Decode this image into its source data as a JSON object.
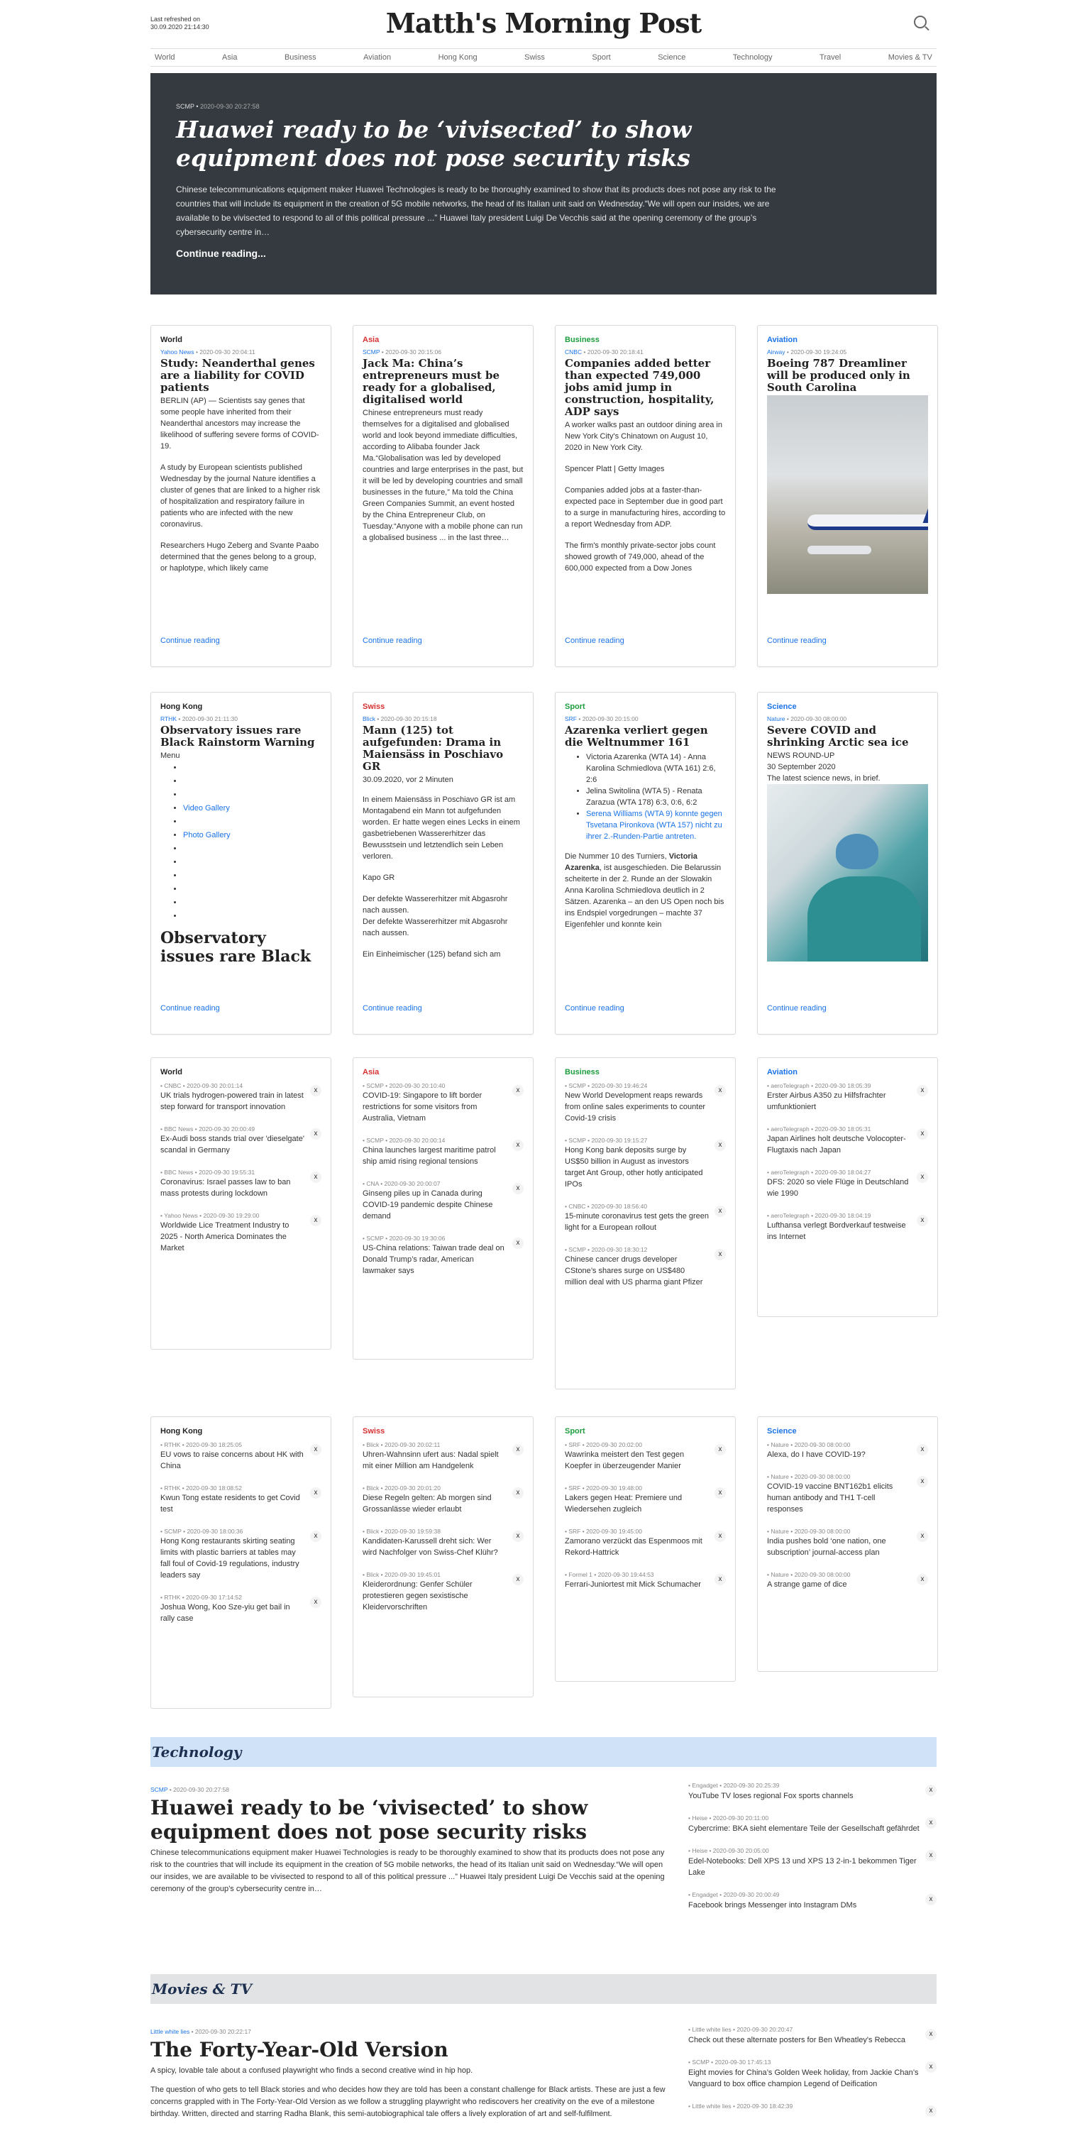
{
  "header": {
    "refresh_label": "Last refreshed on",
    "refresh_time": "30.09.2020 21:14:30",
    "title": "Matth's Morning Post"
  },
  "nav": [
    "World",
    "Asia",
    "Business",
    "Aviation",
    "Hong Kong",
    "Swiss",
    "Sport",
    "Science",
    "Technology",
    "Travel",
    "Movies & TV"
  ],
  "hero": {
    "source": "SCMP",
    "time": "2020-09-30 20:27:58",
    "title": "Huawei ready to be ‘vivisected’ to show equipment does not pose security risks",
    "summary": "Chinese telecommunications equipment maker Huawei Technologies is ready to be thoroughly examined to show that its products does not pose any risk to the countries that will include its equipment in the creation of 5G mobile networks, the head of its Italian unit said on Wednesday.“We will open our insides, we are available to be vivisected to respond to all of this political pressure ...” Huawei Italy president Luigi De Vecchis said at the opening ceremony of the group’s cybersecurity centre in…",
    "more": "Continue reading..."
  },
  "colors": {
    "World": "#222222",
    "Asia": "#d63031",
    "Business": "#1e9e3e",
    "Aviation": "#1a73e8",
    "Hong Kong": "#222222",
    "Swiss": "#d63031",
    "Sport": "#1e9e3e",
    "Science": "#1a73e8",
    "tech_bar": "#cfe2f8",
    "movies_bar": "#e2e3e5"
  },
  "cards": [
    {
      "cat": "World",
      "src": "Yahoo News",
      "time": "2020-09-30 20:04:11",
      "title": "Study: Neanderthal genes are a liability for COVID patients",
      "paras": [
        "BERLIN (AP) — Scientists say genes that some people have inherited from their Neanderthal ancestors may increase the likelihood of suffering severe forms of COVID-19.",
        "A study by European scientists published Wednesday by the journal Nature identifies a cluster of genes that are linked to a higher risk of hospitalization and respiratory failure in patients who are infected with the new coronavirus.",
        "Researchers Hugo Zeberg and Svante Paabo determined that the genes belong to a group, or haplotype, which likely came"
      ],
      "more": "Continue reading"
    },
    {
      "cat": "Asia",
      "src": "SCMP",
      "time": "2020-09-30 20:15:06",
      "title": "Jack Ma: China’s entrepreneurs must be ready for a globalised, digitalised world",
      "paras": [
        "Chinese entrepreneurs must ready themselves for a digitalised and globalised world and look beyond immediate difficulties, according to Alibaba founder Jack Ma.“Globalisation was led by developed countries and large enterprises in the past, but it will be led by developing countries and small businesses in the future,” Ma told the China Green Companies Summit, an event hosted by the China Entrepreneur Club, on Tuesday.“Anyone with a mobile phone can run a globalised business ... in the last three…"
      ],
      "more": "Continue reading"
    },
    {
      "cat": "Business",
      "src": "CNBC",
      "time": "2020-09-30 20:18:41",
      "title": "Companies added better than expected 749,000 jobs amid jump in construction, hospitality, ADP says",
      "paras": [
        "A worker walks past an outdoor dining area in New York City's Chinatown on August 10, 2020 in New York City.",
        "Spencer Platt | Getty Images",
        "Companies added jobs at a faster-than-expected pace in September due in good part to a surge in manufacturing hires, according to a report Wednesday from ADP.",
        "The firm's monthly private-sector jobs count showed growth of 749,000, ahead of the 600,000 expected from a Dow Jones"
      ],
      "more": "Continue reading"
    },
    {
      "cat": "Aviation",
      "src": "Airway",
      "time": "2020-09-30 19:24:05",
      "title": "Boeing 787 Dreamliner will be produced only in South Carolina",
      "paras": [],
      "more": "Continue reading"
    },
    {
      "cat": "Hong Kong",
      "src": "RTHK",
      "time": "2020-09-30 21:11:30",
      "title": "Observatory issues rare Black Rainstorm Warning",
      "menu": "Menu",
      "links": [
        "Video Gallery",
        "Photo Gallery"
      ],
      "bigtitle": "Observatory issues rare Black Rainstorm Warning",
      "more": "Continue reading"
    },
    {
      "cat": "Swiss",
      "src": "Blick",
      "time": "2020-09-30 20:15:18",
      "title": "Mann (125) tot aufgefunden: Drama in Maiensäss in Poschiavo GR",
      "date": "30.09.2020, vor 2 Minuten",
      "paras": [
        "In einem Maiensäss in Poschiavo GR ist am Montagabend ein Mann tot aufgefunden worden. Er hatte wegen eines Lecks in einem gasbetriebenen Wassererhitzer das Bewusstsein und letztendlich sein Leben verloren.",
        "Kapo GR",
        "Der defekte Wassererhitzer mit Abgasrohr nach aussen.\nDer defekte Wassererhitzer mit Abgasrohr nach aussen.",
        "Ein Einheimischer (125) befand sich am"
      ],
      "more": "Continue reading"
    },
    {
      "cat": "Sport",
      "src": "SRF",
      "time": "2020-09-30 20:15:00",
      "title": "Azarenka verliert gegen die Weltnummer 161",
      "bullets": [
        "Victoria Azarenka (WTA 14) - Anna Karolina Schmiedlova (WTA 161) 2:6, 2:6",
        "Jelina Switolina (WTA 5) - Renata Zarazua (WTA 178) 6:3, 0:6, 6:2"
      ],
      "link": "Serena Williams (WTA 9) konnte gegen Tsvetana Pironkova (WTA 157) nicht zu ihrer 2.-Runden-Partie antreten.",
      "para_pre": "Die Nummer 10 des Turniers, ",
      "para_bold": "Victoria Azarenka",
      "para_post": ", ist ausgeschieden. Die Belarussin scheiterte in der 2. Runde an der Slowakin Anna Karolina Schmiedlova deutlich in 2 Sätzen. Azarenka – an den US Open noch bis ins Endspiel vorgedrungen – machte 37 Eigenfehler und konnte kein",
      "more": "Continue reading"
    },
    {
      "cat": "Science",
      "src": "Nature",
      "time": "2020-09-30 08:00:00",
      "title": "Severe COVID and shrinking Arctic sea ice",
      "lines": [
        "NEWS ROUND-UP",
        "30 September 2020",
        "The latest science news, in brief."
      ],
      "more": "Continue reading"
    }
  ],
  "lists1": [
    {
      "cat": "World",
      "items": [
        {
          "src": "CNBC",
          "time": "2020-09-30 20:01:14",
          "title": "UK trials hydrogen-powered train in latest step forward for transport innovation"
        },
        {
          "src": "BBC News",
          "time": "2020-09-30 20:00:49",
          "title": "Ex-Audi boss stands trial over 'dieselgate' scandal in Germany"
        },
        {
          "src": "BBC News",
          "time": "2020-09-30 19:55:31",
          "title": "Coronavirus: Israel passes law to ban mass protests during lockdown"
        },
        {
          "src": "Yahoo News",
          "time": "2020-09-30 19:29:00",
          "title": "Worldwide Lice Treatment Industry to 2025 - North America Dominates the Market"
        }
      ]
    },
    {
      "cat": "Asia",
      "items": [
        {
          "src": "SCMP",
          "time": "2020-09-30 20:10:40",
          "title": "COVID-19: Singapore to lift border restrictions for some visitors from Australia, Vietnam"
        },
        {
          "src": "SCMP",
          "time": "2020-09-30 20:00:14",
          "title": "China launches largest maritime patrol ship amid rising regional tensions"
        },
        {
          "src": "CNA",
          "time": "2020-09-30 20:00:07",
          "title": "Ginseng piles up in Canada during COVID-19 pandemic despite Chinese demand"
        },
        {
          "src": "SCMP",
          "time": "2020-09-30 19:30:06",
          "title": "US-China relations: Taiwan trade deal on Donald Trump’s radar, American lawmaker says"
        }
      ]
    },
    {
      "cat": "Business",
      "items": [
        {
          "src": "SCMP",
          "time": "2020-09-30 19:46:24",
          "title": "New World Development reaps rewards from online sales experiments to counter Covid-19 crisis"
        },
        {
          "src": "SCMP",
          "time": "2020-09-30 19:15:27",
          "title": "Hong Kong bank deposits surge by US$50 billion in August as investors target Ant Group, other hotly anticipated IPOs"
        },
        {
          "src": "CNBC",
          "time": "2020-09-30 18:56:40",
          "title": "15-minute coronavirus test gets the green light for a European rollout"
        },
        {
          "src": "SCMP",
          "time": "2020-09-30 18:30:12",
          "title": "Chinese cancer drugs developer CStone’s shares surge on US$480 million deal with US pharma giant Pfizer"
        }
      ]
    },
    {
      "cat": "Aviation",
      "items": [
        {
          "src": "aeroTelegraph",
          "time": "2020-09-30 18:05:39",
          "title": "Erster Airbus A350 zu Hilfsfrachter umfunktioniert"
        },
        {
          "src": "aeroTelegraph",
          "time": "2020-09-30 18:05:31",
          "title": "Japan Airlines holt deutsche Volocopter-Flugtaxis nach Japan"
        },
        {
          "src": "aeroTelegraph",
          "time": "2020-09-30 18:04:27",
          "title": "DFS: 2020 so viele Flüge in Deutschland wie 1990"
        },
        {
          "src": "aeroTelegraph",
          "time": "2020-09-30 18:04:19",
          "title": "Lufthansa verlegt Bordverkauf testweise ins Internet"
        }
      ]
    }
  ],
  "lists2": [
    {
      "cat": "Hong Kong",
      "items": [
        {
          "src": "RTHK",
          "time": "2020-09-30 18:25:05",
          "title": "EU vows to raise concerns about HK with China"
        },
        {
          "src": "RTHK",
          "time": "2020-09-30 18:08:52",
          "title": "Kwun Tong estate residents to get Covid test"
        },
        {
          "src": "SCMP",
          "time": "2020-09-30 18:00:36",
          "title": "Hong Kong restaurants skirting seating limits with plastic barriers at tables may fall foul of Covid-19 regulations, industry leaders say"
        },
        {
          "src": "RTHK",
          "time": "2020-09-30 17:14:52",
          "title": "Joshua Wong, Koo Sze-yiu get bail in rally case"
        }
      ]
    },
    {
      "cat": "Swiss",
      "items": [
        {
          "src": "Blick",
          "time": "2020-09-30 20:02:11",
          "title": "Uhren-Wahnsinn ufert aus: Nadal spielt mit einer Million am Handgelenk"
        },
        {
          "src": "Blick",
          "time": "2020-09-30 20:01:20",
          "title": "Diese Regeln gelten: Ab morgen sind Grossanlässe wieder erlaubt"
        },
        {
          "src": "Blick",
          "time": "2020-09-30 19:59:38",
          "title": "Kandidaten-Karussell dreht sich: Wer wird Nachfolger von Swiss-Chef Klühr?"
        },
        {
          "src": "Blick",
          "time": "2020-09-30 19:45:01",
          "title": "Kleiderordnung: Genfer Schüler protestieren gegen sexistische Kleidervorschriften"
        }
      ]
    },
    {
      "cat": "Sport",
      "items": [
        {
          "src": "SRF",
          "time": "2020-09-30 20:02:00",
          "title": "Wawrinka meistert den Test gegen Koepfer in überzeugender Manier"
        },
        {
          "src": "SRF",
          "time": "2020-09-30 19:48:00",
          "title": "Lakers gegen Heat: Premiere und Wiedersehen zugleich"
        },
        {
          "src": "SRF",
          "time": "2020-09-30 19:45:00",
          "title": "Zamorano verzückt das Espenmoos mit Rekord-Hattrick"
        },
        {
          "src": "Formel 1",
          "time": "2020-09-30 19:44:53",
          "title": "Ferrari-Juniortest mit Mick Schumacher"
        }
      ]
    },
    {
      "cat": "Science",
      "items": [
        {
          "src": "Nature",
          "time": "2020-09-30 08:00:00",
          "title": "Alexa, do I have COVID-19?"
        },
        {
          "src": "Nature",
          "time": "2020-09-30 08:00:00",
          "title": "COVID-19 vaccine BNT162b1 elicits human antibody and TH1 T-cell responses"
        },
        {
          "src": "Nature",
          "time": "2020-09-30 08:00:00",
          "title": "India pushes bold ‘one nation, one subscription’ journal-access plan"
        },
        {
          "src": "Nature",
          "time": "2020-09-30 08:00:00",
          "title": "A strange game of dice"
        }
      ]
    }
  ],
  "x_label": "x",
  "technology": {
    "label": "Technology",
    "src": "SCMP",
    "time": "2020-09-30 20:27:58",
    "title": "Huawei ready to be ‘vivisected’ to show equipment does not pose security risks",
    "summary": "Chinese telecommunications equipment maker Huawei Technologies is ready to be thoroughly examined to show that its products does not pose any risk to the countries that will include its equipment in the creation of 5G mobile networks, the head of its Italian unit said on Wednesday.“We will open our insides, we are available to be vivisected to respond to all of this political pressure ...” Huawei Italy president Luigi De Vecchis said at the opening ceremony of the group’s cybersecurity centre in…",
    "side": [
      {
        "src": "Engadget",
        "time": "2020-09-30 20:25:39",
        "title": "YouTube TV loses regional Fox sports channels"
      },
      {
        "src": "Heise",
        "time": "2020-09-30 20:11:00",
        "title": "Cybercrime: BKA sieht elementare Teile der Gesellschaft gefährdet"
      },
      {
        "src": "Heise",
        "time": "2020-09-30 20:05:00",
        "title": "Edel-Notebooks: Dell XPS 13 und XPS 13 2-in-1 bekommen Tiger Lake"
      },
      {
        "src": "Engadget",
        "time": "2020-09-30 20:00:49",
        "title": "Facebook brings Messenger into Instagram DMs"
      }
    ]
  },
  "movies": {
    "label": "Movies & TV",
    "src": "Little white lies",
    "time": "2020-09-30 20:22:17",
    "title": "The Forty-Year-Old Version",
    "summary1": "A spicy, lovable tale about a confused playwright who finds a second creative wind in hip hop.",
    "summary2": "The question of who gets to tell Black stories and who decides how they are told has been a constant challenge for Black artists. These are just a few concerns grappled with in The Forty-Year-Old Version as we follow a struggling playwright who rediscovers her creativity on the eve of a milestone birthday. Written, directed and starring Radha Blank, this semi-autobiographical tale offers a lively exploration of art and self-fulfilment.",
    "side": [
      {
        "src": "Little white lies",
        "time": "2020-09-30 20:20:47",
        "title": "Check out these alternate posters for Ben Wheatley's Rebecca"
      },
      {
        "src": "SCMP",
        "time": "2020-09-30 17:45:13",
        "title": "Eight movies for China’s Golden Week holiday, from Jackie Chan’s Vanguard to box office champion Legend of Deification"
      },
      {
        "src": "Little white lies",
        "time": "2020-09-30 18:42:39",
        "title": ""
      }
    ]
  }
}
